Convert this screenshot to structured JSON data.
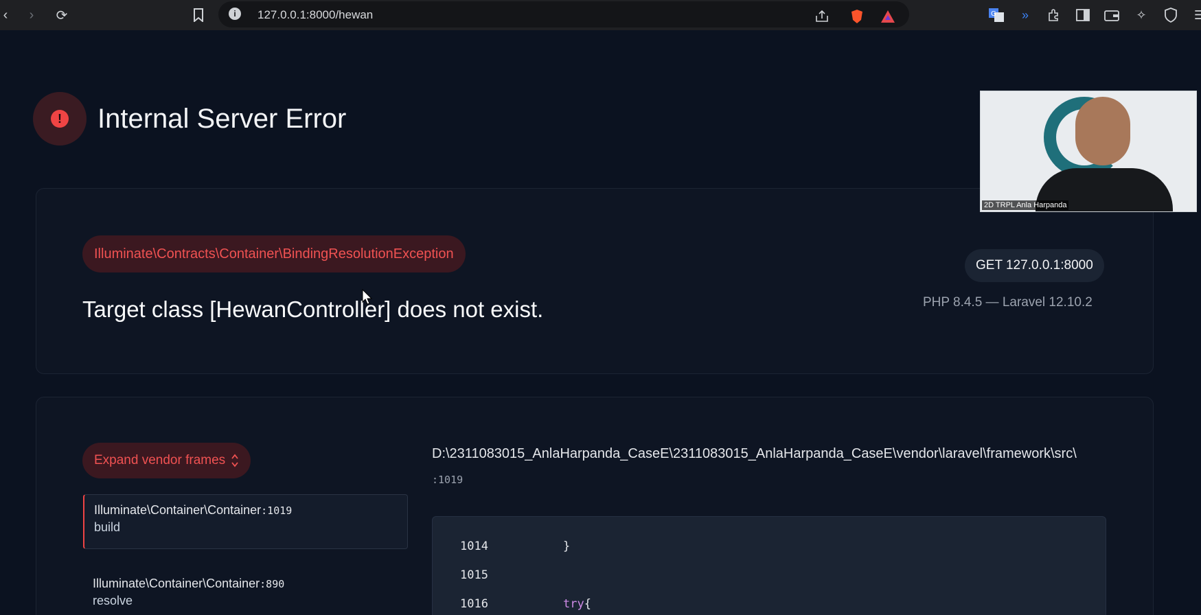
{
  "browser": {
    "url": "127.0.0.1:8000/hewan"
  },
  "error": {
    "title": "Internal Server Error",
    "exception_class": "Illuminate\\Contracts\\Container\\BindingResolutionException",
    "message": "Target class [HewanController] does not exist.",
    "request": "GET 127.0.0.1:8000",
    "versions": "PHP 8.4.5 — Laravel 12.10.2"
  },
  "frames": {
    "expand_label": "Expand vendor frames",
    "items": [
      {
        "class": "Illuminate\\Container\\Container",
        "line": ":1019",
        "function": "build"
      },
      {
        "class": "Illuminate\\Container\\Container",
        "line": ":890",
        "function": "resolve"
      }
    ]
  },
  "source": {
    "path": "D:\\2311083015_AnlaHarpanda_CaseE\\2311083015_AnlaHarpanda_CaseE\\vendor\\laravel\\framework\\src\\",
    "line": ":1019",
    "code": [
      {
        "num": "1014",
        "text": "}"
      },
      {
        "num": "1015",
        "text": ""
      },
      {
        "num": "1016",
        "kw": "try",
        "text": " {"
      }
    ]
  },
  "webcam": {
    "label": "2D TRPL Anla Harpanda"
  },
  "colors": {
    "accent_red": "#ef4444",
    "background": "#0b1220"
  }
}
